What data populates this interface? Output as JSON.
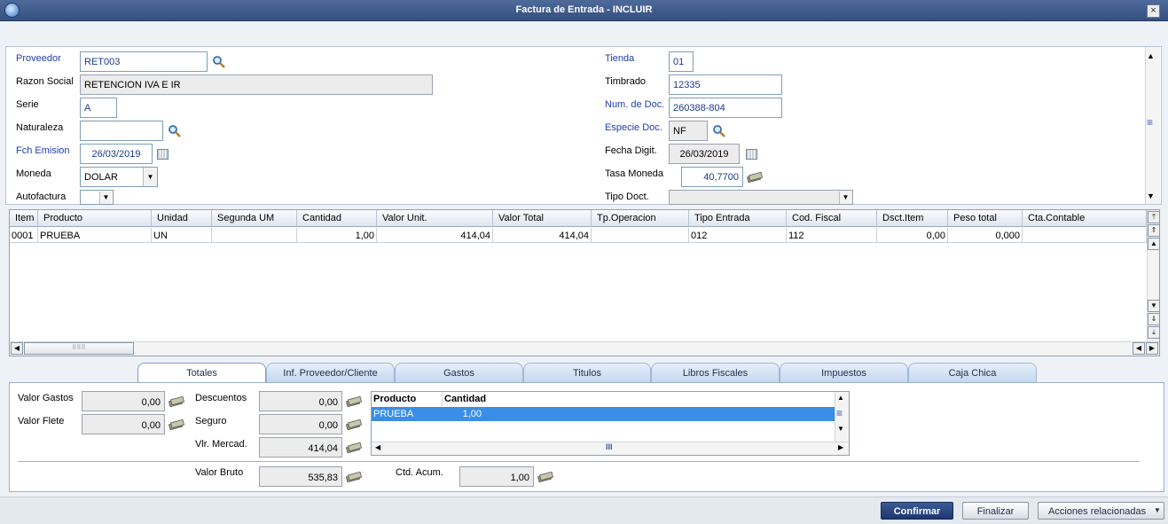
{
  "window": {
    "title": "Factura de Entrada - INCLUIR",
    "close": "×"
  },
  "header": {
    "proveedor": {
      "label": "Proveedor",
      "value": "RET003"
    },
    "razon_social": {
      "label": "Razon Social",
      "value": "RETENCION IVA E IR"
    },
    "serie": {
      "label": "Serie",
      "value": "A"
    },
    "naturaleza": {
      "label": "Naturaleza",
      "value": ""
    },
    "fch_emision": {
      "label": "Fch Emision",
      "value": "26/03/2019"
    },
    "moneda": {
      "label": "Moneda",
      "value": "DOLAR"
    },
    "autofactura": {
      "label": "Autofactura",
      "value": ""
    },
    "tienda": {
      "label": "Tienda",
      "value": "01"
    },
    "timbrado": {
      "label": "Timbrado",
      "value": "12335"
    },
    "num_doc": {
      "label": "Num. de Doc.",
      "value": "260388-804"
    },
    "especie_doc": {
      "label": "Especie Doc.",
      "value": "NF"
    },
    "fecha_digit": {
      "label": "Fecha Digit.",
      "value": "26/03/2019"
    },
    "tasa_moneda": {
      "label": "Tasa Moneda",
      "value": "40,7700"
    },
    "tipo_doct": {
      "label": "Tipo Doct.",
      "value": ""
    }
  },
  "grid": {
    "columns": [
      "Item",
      "Producto",
      "Unidad",
      "Segunda UM",
      "Cantidad",
      "Valor Unit.",
      "Valor Total",
      "Tp.Operacion",
      "Tipo Entrada",
      "Cod. Fiscal",
      "Dsct.Item",
      "Peso total",
      "Cta.Contable"
    ],
    "rows": [
      [
        "0001",
        "PRUEBA",
        "UN",
        "",
        "1,00",
        "414,04",
        "414,04",
        "",
        "012",
        "112",
        "0,00",
        "0,000",
        ""
      ]
    ]
  },
  "tabs": [
    "Totales",
    "Inf. Proveedor/Cliente",
    "Gastos",
    "Titulos",
    "Libros Fiscales",
    "Impuestos",
    "Caja Chica"
  ],
  "totales": {
    "valor_gastos": {
      "label": "Valor Gastos",
      "value": "0,00"
    },
    "valor_flete": {
      "label": "Valor Flete",
      "value": "0,00"
    },
    "descuentos": {
      "label": "Descuentos",
      "value": "0,00"
    },
    "seguro": {
      "label": "Seguro",
      "value": "0,00"
    },
    "vlr_mercad": {
      "label": "Vlr. Mercad.",
      "value": "414,04"
    },
    "valor_bruto": {
      "label": "Valor Bruto",
      "value": "535,83"
    },
    "ctd_acum": {
      "label": "Ctd. Acum.",
      "value": "1,00"
    },
    "mini_grid": {
      "columns": [
        "Producto",
        "Cantidad"
      ],
      "rows": [
        [
          "PRUEBA",
          "1,00"
        ]
      ]
    }
  },
  "buttons": {
    "confirmar": "Confirmar",
    "finalizar": "Finalizar",
    "acciones": "Acciones relacionadas"
  },
  "colors": {
    "titlebar": "#3c5789",
    "accent": "#1f3fa8",
    "selected_row": "#3a8ee6",
    "primary_button": "#1d3670"
  }
}
